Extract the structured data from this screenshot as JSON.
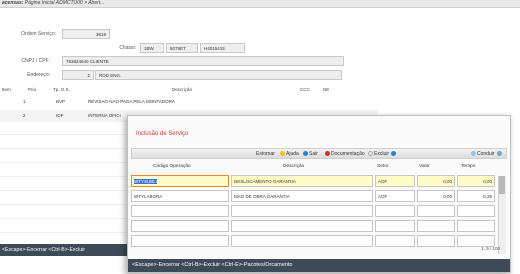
{
  "topbar": {
    "prefix": "acensas:",
    "crumb": "Página Inicial ADMCTU00 > Abert..."
  },
  "form": {
    "ordem_label": "Ordem Serviço:",
    "ordem_value": "3619",
    "chassi_label": "Chassi:",
    "chassi_values": [
      "1BW",
      "5079ET",
      "H4015415"
    ],
    "cnpj_label": "CNPJ / CPF:",
    "cnpj_value": "763824640   CLIENTE",
    "endereco_label": "Endereço:",
    "endereco_num": "2",
    "endereco_value": "ROD ENG."
  },
  "bg_table": {
    "headers": [
      "Item",
      "Prio.",
      "Tp. O.S.",
      "Descrição",
      "CCC",
      "NE"
    ],
    "rows": [
      {
        "item": "1",
        "tipo": "BVP",
        "descricao": "REVISAO NAO PAGA PELA MONTADORA"
      },
      {
        "item": "2",
        "tipo": "IOF",
        "descricao": "INTERNA OFICI"
      }
    ]
  },
  "bg_status": "<Escape>-Encerrar <Ctrl-B>-Excluir",
  "modal": {
    "title": "Inclusão de Serviço",
    "toolbar": {
      "estornar": "Estornar",
      "ajuda": "Ajuda",
      "sair": "Sair",
      "documentacao": "Documentação",
      "excluir": "Excluir",
      "conduir": "Conduir"
    },
    "headers": [
      "Código Operação",
      "Descrição",
      "Setor",
      "Valor",
      "Tempo"
    ],
    "rows": [
      {
        "codigo": "WTYSUBLI",
        "descricao": "DESLOCAMENTO GARANTIA",
        "setor": "AOF",
        "valor": "0,00",
        "tempo": "0,00"
      },
      {
        "codigo": "WTYLABORA",
        "descricao": "MAO DE OBRA GARANTIA",
        "setor": "AOF",
        "valor": "0,00",
        "tempo": "0,28"
      }
    ],
    "paging": "1..5 / 100",
    "status": "<Escape>-Encerrar <Ctrl-B>-Excluir <Ctrl-E>-Pacotes/Orcamento"
  },
  "colors": {
    "status_bg": "#3c4b57",
    "title_red": "#c0392b",
    "selected_row": "#fffcc8"
  }
}
